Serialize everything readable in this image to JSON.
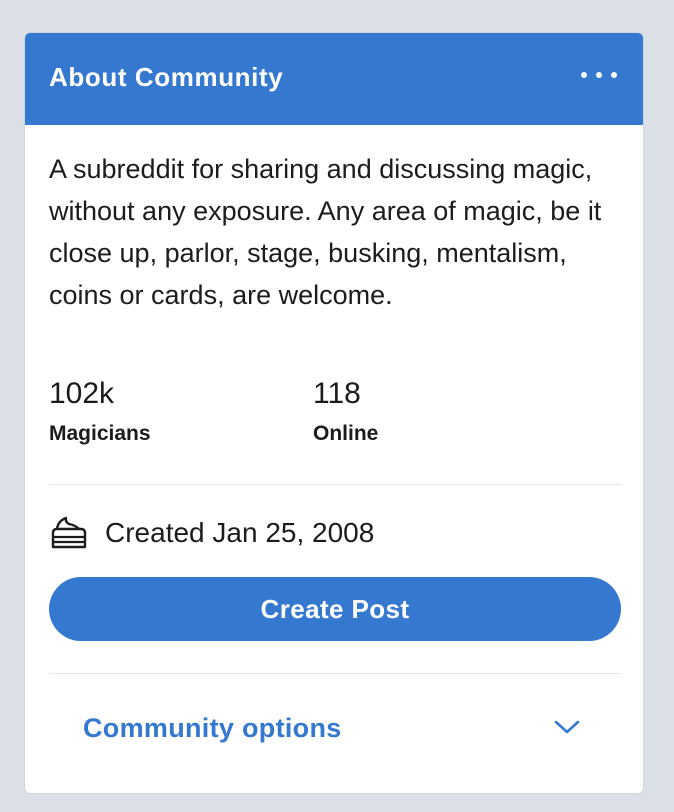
{
  "card": {
    "title": "About Community",
    "description": "A subreddit for sharing and discussing magic, without any exposure. Any area of magic, be it close up, parlor, stage, busking, mentalism, coins or cards, are welcome.",
    "stats": [
      {
        "value": "102k",
        "label": "Magicians"
      },
      {
        "value": "118",
        "label": "Online"
      }
    ],
    "created": "Created Jan 25, 2008",
    "create_post_label": "Create Post",
    "community_options_label": "Community options",
    "icons": {
      "more": "more-horizontal-icon",
      "created": "cake-icon",
      "options": "chevron-down-icon"
    }
  },
  "colors": {
    "accent": "#3578cf",
    "background": "#dae0e6",
    "text": "#1c1c1c"
  }
}
